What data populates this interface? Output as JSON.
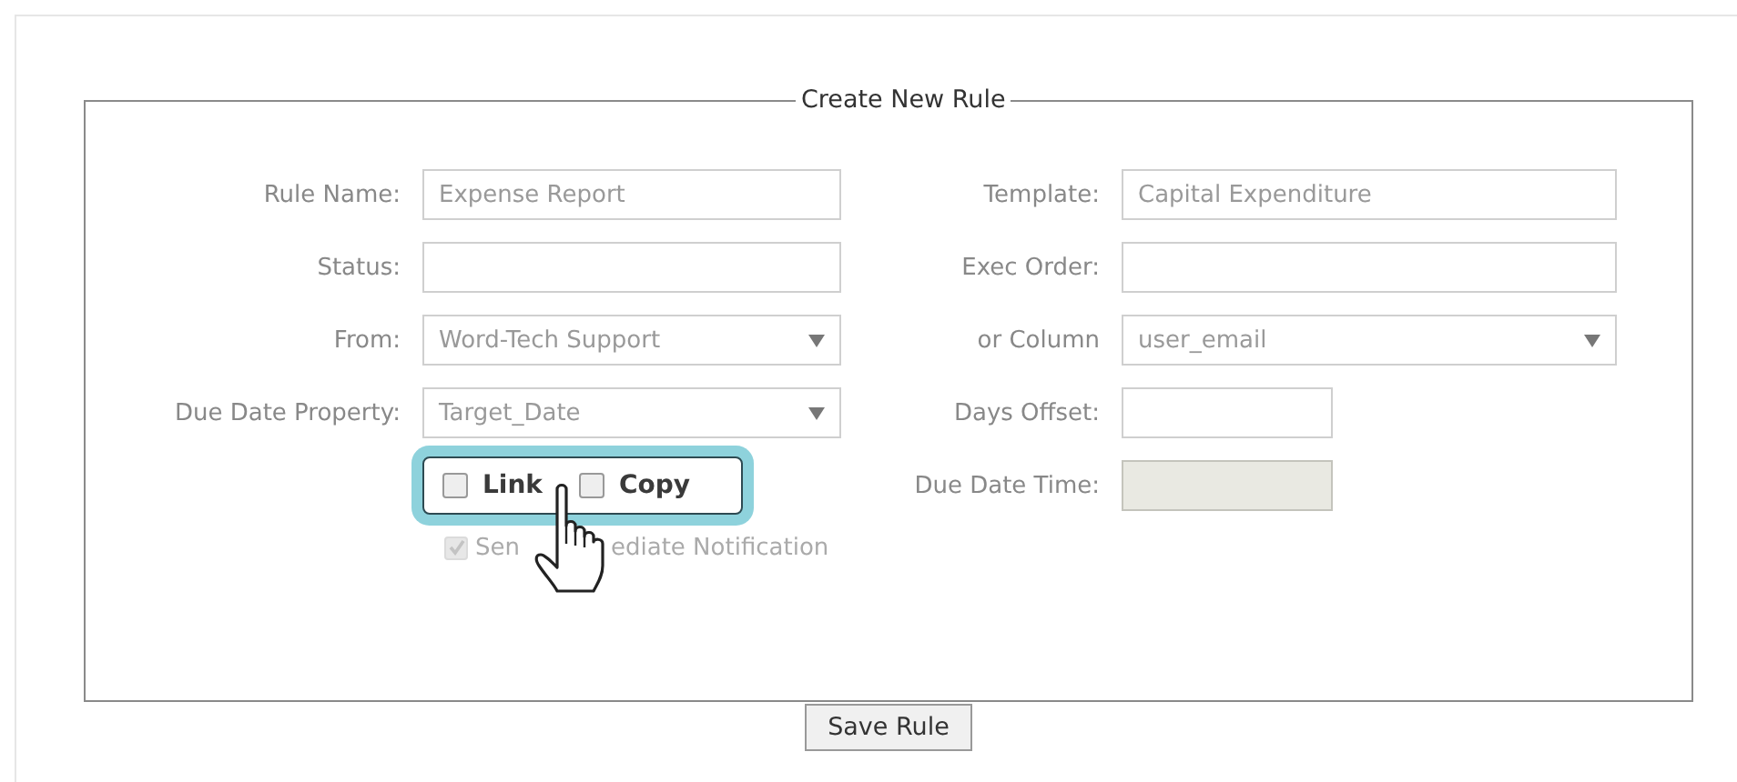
{
  "form": {
    "legend": "Create New Rule",
    "rows": [
      {
        "left": {
          "label": "Rule Name:",
          "kind": "text",
          "value": "Expense Report",
          "disabled": false
        },
        "right": {
          "label": "Template:",
          "kind": "text",
          "value": "Capital Expenditure",
          "disabled": false
        }
      },
      {
        "left": {
          "label": "Status:",
          "kind": "text",
          "disabled": false
        },
        "right": {
          "label": "Exec Order:",
          "kind": "text",
          "disabled": false
        }
      },
      {
        "left": {
          "label": "From:",
          "kind": "select",
          "value": "Word-Tech Support",
          "disabled": false
        },
        "right": {
          "label": "or Column",
          "kind": "select",
          "value": "user_email",
          "disabled": false
        }
      },
      {
        "left": {
          "label": "Due Date Property:",
          "kind": "select",
          "value": "Target_Date",
          "disabled": false
        },
        "right": {
          "label": "Days Offset:",
          "kind": "short",
          "disabled": false
        }
      },
      {
        "left": {
          "kind": "checkboxes",
          "highlighted": true,
          "options": [
            {
              "label": "Link",
              "checked": false
            },
            {
              "label": "Copy",
              "checked": false
            }
          ]
        },
        "right": {
          "label": "Due Date Time:",
          "kind": "short",
          "disabled": true
        }
      },
      {
        "left": {
          "kind": "checkbox",
          "label_parts": [
            "Sen",
            "ediate Notification"
          ],
          "checked": true,
          "disabled": true
        }
      }
    ],
    "button": "Save Rule"
  }
}
